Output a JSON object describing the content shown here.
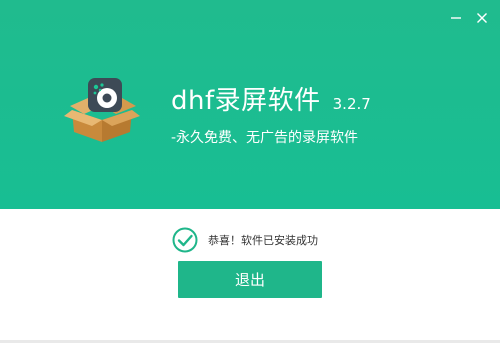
{
  "app": {
    "name": "dhf录屏软件",
    "version": "3.2.7",
    "tagline": "-永久免费、无广告的录屏软件"
  },
  "status": {
    "message": "恭喜！软件已安装成功"
  },
  "actions": {
    "exit_label": "退出"
  },
  "colors": {
    "header_green": "#1cbd91",
    "button_green": "#1fb68a",
    "check_green": "#1fb68a"
  },
  "icons": {
    "minimize": "minimize-icon",
    "close": "close-icon",
    "logo": "software-box-icon",
    "success": "check-circle-icon"
  }
}
